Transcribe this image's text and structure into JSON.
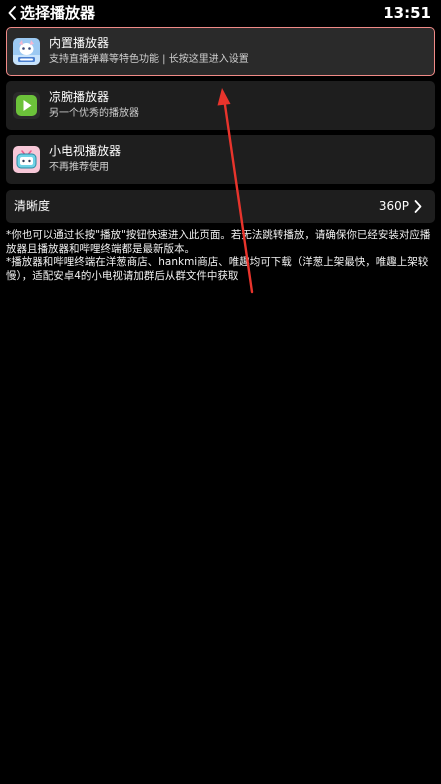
{
  "header": {
    "title": "选择播放器",
    "time": "13:51"
  },
  "players": [
    {
      "title": "内置播放器",
      "subtitle": "支持直播弹幕等特色功能 | 长按这里进入设置",
      "icon": "builtin-player-icon",
      "selected": true
    },
    {
      "title": "凉腕播放器",
      "subtitle": "另一个优秀的播放器",
      "icon": "play-icon",
      "selected": false
    },
    {
      "title": "小电视播放器",
      "subtitle": "不再推荐使用",
      "icon": "tv-mascot-icon",
      "selected": false
    }
  ],
  "quality": {
    "label": "清晰度",
    "value": "360P"
  },
  "notes": [
    "*你也可以通过长按\"播放\"按钮快速进入此页面。若无法跳转播放，请确保你已经安装对应播放器且播放器和哔哩终端都是最新版本。",
    "*播放器和哔哩终端在洋葱商店、hankmi商店、唯趣均可下载（洋葱上架最快，唯趣上架较慢），适配安卓4的小电视请加群后从群文件中获取"
  ],
  "colors": {
    "background": "#000000",
    "card": "#1e1e1e",
    "selected_border": "#f08a87",
    "annotation_arrow": "#e8342c"
  }
}
